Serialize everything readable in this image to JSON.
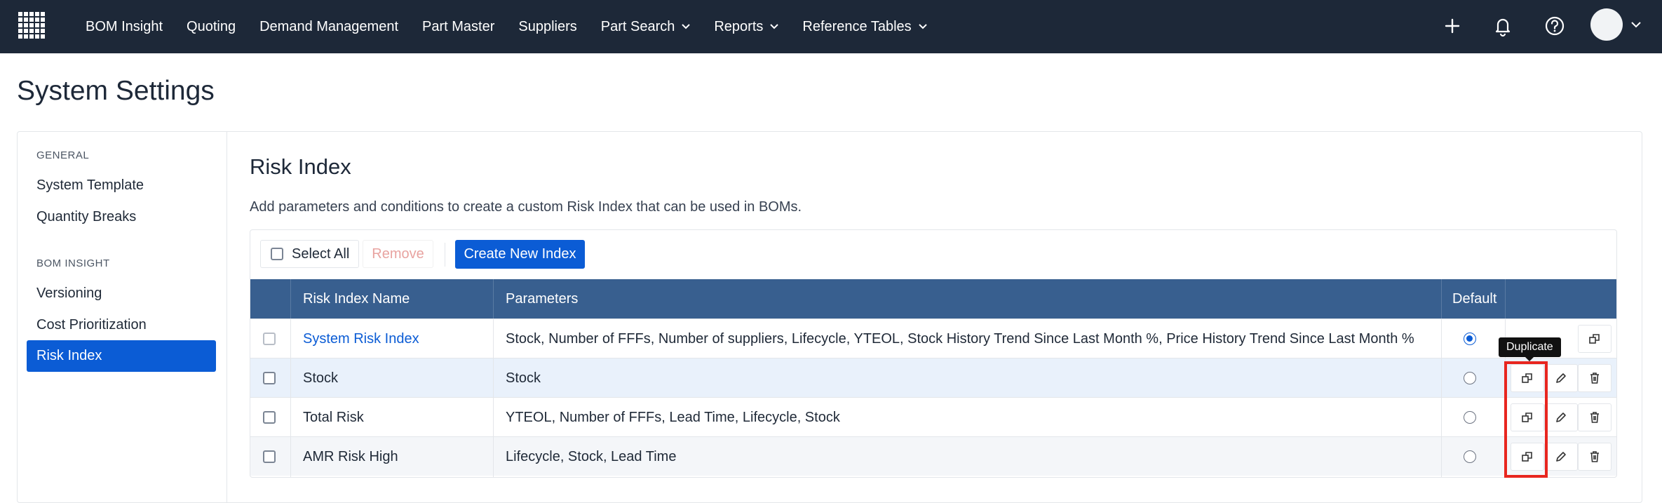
{
  "nav": {
    "items": [
      "BOM Insight",
      "Quoting",
      "Demand Management",
      "Part Master",
      "Suppliers",
      "Part Search",
      "Reports",
      "Reference Tables"
    ],
    "dropdown_items": [
      "Part Search",
      "Reports",
      "Reference Tables"
    ],
    "right_icons": [
      "plus-icon",
      "bell-icon",
      "help-icon",
      "avatar"
    ]
  },
  "page": {
    "title": "System Settings"
  },
  "sidebar": {
    "sections": [
      {
        "heading": "GENERAL",
        "items": [
          "System Template",
          "Quantity Breaks"
        ]
      },
      {
        "heading": "BOM INSIGHT",
        "items": [
          "Versioning",
          "Cost Prioritization",
          "Risk Index"
        ]
      }
    ],
    "active_item": "Risk Index"
  },
  "content": {
    "title": "Risk Index",
    "description": "Add parameters and conditions to create a custom Risk Index that can be used in BOMs."
  },
  "toolbar": {
    "select_all": "Select All",
    "remove": "Remove",
    "create": "Create New Index"
  },
  "table": {
    "headers": {
      "name": "Risk Index Name",
      "parameters": "Parameters",
      "default": "Default"
    },
    "rows": [
      {
        "name": "System Risk Index",
        "parameters": "Stock, Number of FFFs, Number of suppliers, Lifecycle, YTEOL, Stock History Trend Since Last Month %, Price History Trend Since Last Month %",
        "default": true,
        "link": true
      },
      {
        "name": "Stock",
        "parameters": "Stock",
        "default": false
      },
      {
        "name": "Total Risk",
        "parameters": "YTEOL, Number of FFFs, Lead Time, Lifecycle, Stock",
        "default": false
      },
      {
        "name": "AMR Risk High",
        "parameters": "Lifecycle, Stock, Lead Time",
        "default": false
      }
    ]
  },
  "tooltip": {
    "text": "Duplicate"
  },
  "colors": {
    "nav_bg": "#1d2838",
    "accent": "#0b5cd5",
    "table_header": "#385f8f",
    "highlight": "#e8261f"
  }
}
